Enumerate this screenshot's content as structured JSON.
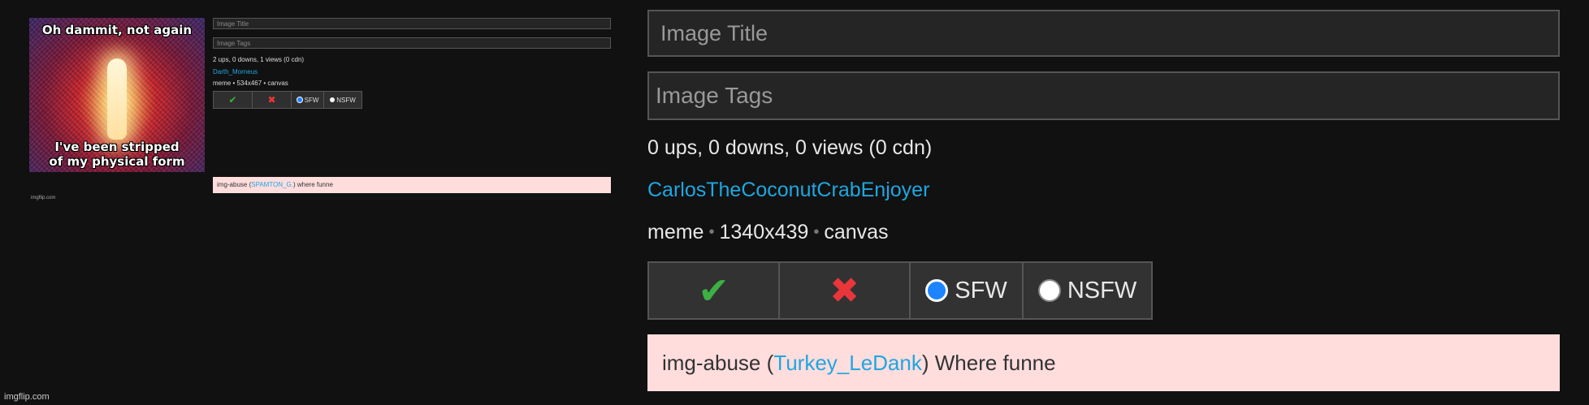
{
  "small_panel": {
    "meme_top_text": "Oh dammit, not again",
    "meme_bottom_text_1": "I've been stripped",
    "meme_bottom_text_2": "of my physical form",
    "title_placeholder": "Image Title",
    "tags_placeholder": "Image Tags",
    "stats": "2 ups, 0 downs, 1 views (0 cdn)",
    "username": "Darth_Morneus",
    "meta": "meme • 534x467 • canvas",
    "sfw_label": "SFW",
    "nsfw_label": "NSFW",
    "abuse_prefix": "img-abuse (",
    "abuse_user": "SPAMTON_G.",
    "abuse_suffix": ") where funne",
    "watermark": "imgflip.com"
  },
  "large_panel": {
    "title_placeholder": "Image Title",
    "tags_placeholder": "Image Tags",
    "stats": "0 ups, 0 downs, 0 views (0 cdn)",
    "username": "CarlosTheCoconutCrabEnjoyer",
    "meta_type": "meme",
    "meta_size": "1340x439",
    "meta_source": "canvas",
    "separator": "•",
    "approve_icon": "✔",
    "reject_icon": "✖",
    "sfw_label": "SFW",
    "nsfw_label": "NSFW",
    "selected_rating": "SFW",
    "abuse_prefix": "img-abuse (",
    "abuse_user": "Turkey_LeDank",
    "abuse_suffix": ") Where funne"
  },
  "footer": {
    "watermark": "imgflip.com"
  },
  "colors": {
    "background": "#111111",
    "link": "#1ea7e1",
    "approve": "#3cb043",
    "reject": "#e8363a",
    "abuse_bg": "#ffdddd",
    "radio_selected": "#1d84ff"
  }
}
